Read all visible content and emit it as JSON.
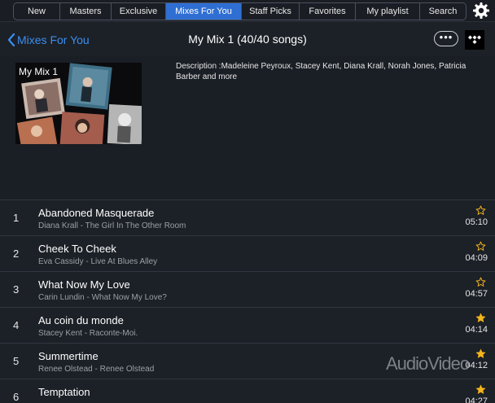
{
  "nav": {
    "tabs": [
      {
        "label": "New",
        "active": false
      },
      {
        "label": "Masters",
        "active": false
      },
      {
        "label": "Exclusive",
        "active": false
      },
      {
        "label": "Mixes For You",
        "active": true
      },
      {
        "label": "Staff Picks",
        "active": false
      },
      {
        "label": "Favorites",
        "active": false
      },
      {
        "label": "My playlist",
        "active": false
      },
      {
        "label": "Search",
        "active": false
      }
    ],
    "settings_icon": "gear-icon"
  },
  "header": {
    "back_label": "Mixes For You",
    "title": "My Mix 1 (40/40 songs)",
    "more_label": "•••",
    "service_icon": "tidal-logo-icon"
  },
  "mix": {
    "cover_title": "My Mix 1",
    "description": "Description :Madeleine Peyroux, Stacey Kent, Diana Krall, Norah Jones, Patricia Barber  and more"
  },
  "tracks": [
    {
      "num": "1",
      "title": "Abandoned Masquerade",
      "subtitle": "Diana Krall - The Girl In The Other Room",
      "duration": "05:10",
      "favorite": false
    },
    {
      "num": "2",
      "title": "Cheek To Cheek",
      "subtitle": "Eva Cassidy - Live At Blues Alley",
      "duration": "04:09",
      "favorite": false
    },
    {
      "num": "3",
      "title": "What Now My Love",
      "subtitle": "Carin Lundin - What Now My Love?",
      "duration": "04:57",
      "favorite": false
    },
    {
      "num": "4",
      "title": "Au coin du monde",
      "subtitle": "Stacey Kent - Raconte-Moi.",
      "duration": "04:14",
      "favorite": true
    },
    {
      "num": "5",
      "title": "Summertime",
      "subtitle": "Renee Olstead - Renee Olstead",
      "duration": "04:12",
      "favorite": true
    },
    {
      "num": "6",
      "title": "Temptation",
      "subtitle": "",
      "duration": "04:27",
      "favorite": true
    }
  ],
  "colors": {
    "accent": "#2f6fd3",
    "link": "#3b8ff0",
    "star": "#f2b51c"
  },
  "watermark": "AudioVideo"
}
